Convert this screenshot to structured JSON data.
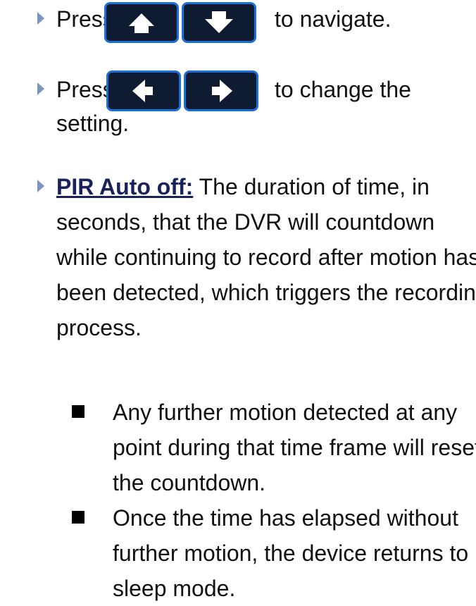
{
  "nav_instruction": {
    "prefix": "Press",
    "suffix": "to navigate.",
    "keys": [
      "up-arrow-icon",
      "down-arrow-icon"
    ]
  },
  "change_instruction": {
    "prefix": "Press",
    "suffix": "to change the",
    "continuation": "setting.",
    "keys": [
      "left-arrow-icon",
      "right-arrow-icon"
    ]
  },
  "pir_section": {
    "title": "PIR Auto off:",
    "lines": [
      "The duration of time, in",
      "seconds, that the DVR will countdown",
      "while continuing to record after motion has",
      "been detected, which triggers the recording",
      "process."
    ],
    "sub_bullets": [
      {
        "lines": [
          "Any further motion detected at any",
          "point during that time frame will reset",
          "the countdown."
        ]
      },
      {
        "lines": [
          "Once the time has elapsed without",
          "further motion, the device returns to",
          "sleep mode."
        ]
      }
    ]
  },
  "colors": {
    "bullet": "#7a96c5",
    "key_fill": "#0f1b30",
    "key_border": "#1b6fd6",
    "title": "#19225a"
  }
}
